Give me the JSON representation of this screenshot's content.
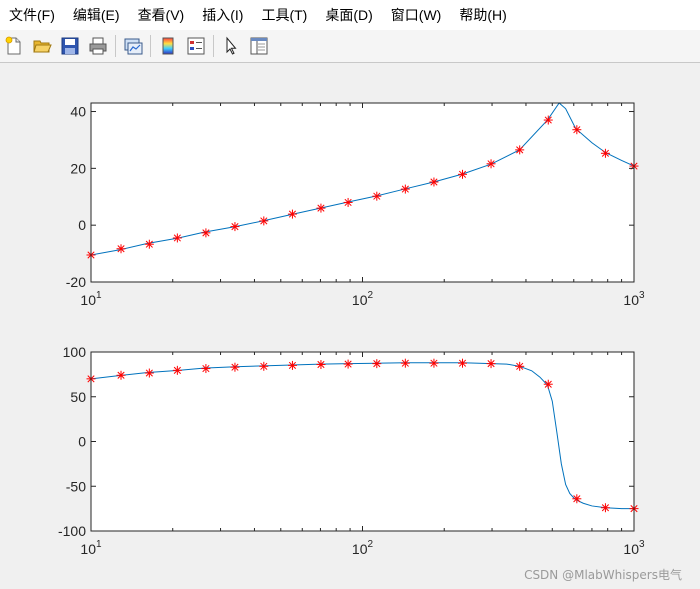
{
  "menu": [
    {
      "label": "文件(F)"
    },
    {
      "label": "编辑(E)"
    },
    {
      "label": "查看(V)"
    },
    {
      "label": "插入(I)"
    },
    {
      "label": "工具(T)"
    },
    {
      "label": "桌面(D)"
    },
    {
      "label": "窗口(W)"
    },
    {
      "label": "帮助(H)"
    }
  ],
  "toolbar": {
    "icons": [
      "new-file-icon",
      "open-folder-icon",
      "save-icon",
      "print-icon",
      "link-plot-icon",
      "colorbar-icon",
      "legend-icon",
      "pointer-icon",
      "property-editor-icon"
    ]
  },
  "colors": {
    "line": "#0072bd",
    "marker": "#ff0000",
    "axes_bg": "#ffffff",
    "figure_bg": "#f0f0f0"
  },
  "watermark": "CSDN @MlabWhispers电气",
  "chart_data": [
    {
      "type": "line",
      "x_scale": "log",
      "xlim": [
        10,
        1000
      ],
      "ylim": [
        -20,
        43
      ],
      "x_tick_labels": [
        {
          "base": "10",
          "exp": "1"
        },
        {
          "base": "10",
          "exp": "2"
        },
        {
          "base": "10",
          "exp": "3"
        }
      ],
      "y_ticks": [
        40,
        20,
        0,
        -20
      ],
      "y_tick_labels": [
        "40",
        "20",
        "0",
        "-20"
      ],
      "grid": false,
      "series": [
        {
          "style": "line",
          "x": [
            10,
            13,
            16,
            21,
            26,
            34,
            43,
            55,
            70,
            89,
            113,
            144,
            183,
            234,
            298,
            379,
            480,
            530,
            560,
            610,
            700,
            787,
            900,
            1000
          ],
          "y": [
            -10.5,
            -8.5,
            -6.5,
            -4.5,
            -2.5,
            -0.5,
            1.5,
            3.8,
            6,
            8.2,
            10.3,
            12.8,
            15.2,
            18,
            21.5,
            26.5,
            37,
            43,
            41,
            34,
            29,
            25.5,
            22.8,
            20.8
          ]
        },
        {
          "style": "markers",
          "x": [
            10,
            12.9,
            16.4,
            20.8,
            26.5,
            33.9,
            43.3,
            55.2,
            70.3,
            88.5,
            112.9,
            143.8,
            183.3,
            233.5,
            297.5,
            379.3,
            483.3,
            615.8,
            784.8,
            1000
          ],
          "y": [
            -10.5,
            -8.3,
            -6.7,
            -4.5,
            -2.7,
            -0.5,
            1.5,
            3.9,
            6,
            8,
            10.2,
            12.7,
            15.2,
            17.9,
            21.6,
            26.5,
            37,
            33.6,
            25.3,
            20.8
          ]
        }
      ]
    },
    {
      "type": "line",
      "x_scale": "log",
      "xlim": [
        10,
        1000
      ],
      "ylim": [
        -100,
        100
      ],
      "x_tick_labels": [
        {
          "base": "10",
          "exp": "1"
        },
        {
          "base": "10",
          "exp": "2"
        },
        {
          "base": "10",
          "exp": "3"
        }
      ],
      "y_ticks": [
        100,
        50,
        0,
        -50,
        -100
      ],
      "y_tick_labels": [
        "100",
        "50",
        "0",
        "-50",
        "-100"
      ],
      "grid": false,
      "series": [
        {
          "style": "line",
          "x": [
            10,
            13,
            16,
            21,
            26,
            34,
            43,
            55,
            70,
            89,
            113,
            144,
            183,
            234,
            298,
            340,
            379,
            420,
            450,
            480,
            500,
            520,
            540,
            560,
            580,
            600,
            620,
            650,
            700,
            787,
            900,
            1000
          ],
          "y": [
            70,
            74,
            77,
            79.5,
            82,
            83.5,
            84.5,
            85.5,
            86.5,
            87,
            87.5,
            88,
            88,
            88,
            87,
            86.5,
            84,
            79,
            72,
            63,
            45,
            10,
            -25,
            -48,
            -58,
            -63,
            -66,
            -69,
            -72,
            -74,
            -75,
            -75
          ]
        },
        {
          "style": "markers",
          "x": [
            10,
            12.9,
            16.4,
            20.8,
            26.5,
            33.9,
            43.3,
            55.2,
            70.3,
            88.5,
            112.9,
            143.8,
            183.3,
            233.5,
            297.5,
            379.3,
            483.3,
            615.8,
            784.8,
            1000
          ],
          "y": [
            70,
            74,
            76.5,
            79.5,
            81.5,
            83,
            84,
            85,
            86,
            86.5,
            87,
            87.5,
            87.5,
            87.5,
            87,
            84,
            64,
            -64,
            -74,
            -75
          ]
        }
      ]
    }
  ]
}
